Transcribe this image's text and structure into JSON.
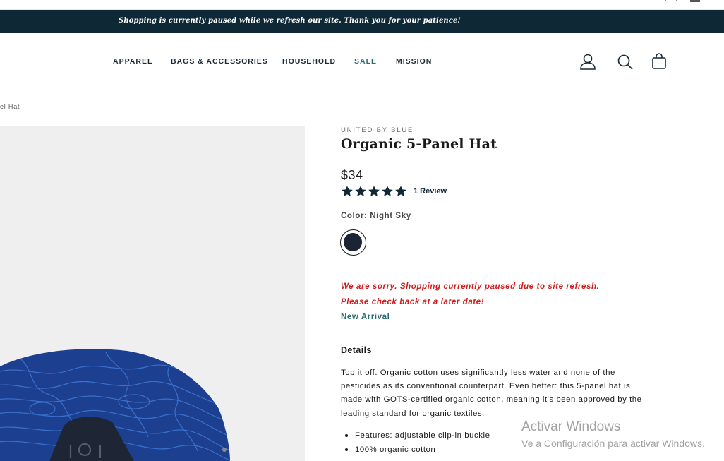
{
  "announcement": "Shopping is currently paused while we refresh our site. Thank you for your patience!",
  "nav": {
    "items": [
      "APPAREL",
      "BAGS & ACCESSORIES",
      "HOUSEHOLD",
      "SALE",
      "MISSION"
    ],
    "icons": [
      "account-icon",
      "search-icon",
      "cart-icon"
    ]
  },
  "breadcrumb": "el Hat",
  "product": {
    "brand": "UNITED BY BLUE",
    "title": "Organic 5-Panel Hat",
    "price": "$34",
    "rating": 5,
    "reviews_label": "1 Review",
    "color_label": "Color: Night Sky",
    "swatch_color": "#1c2332",
    "notice_line1": "We are sorry. Shopping currently paused due to site refresh.",
    "notice_line2": "Please check back at a later date!",
    "badge": "New Arrival",
    "details_heading": "Details",
    "description": "Top it off. Organic cotton uses significantly less water and none of the pesticides as its conventional counterpart. Even better: this 5-panel hat is made with GOTS-certified organic cotton, meaning it's been approved by the leading standard for organic textiles.",
    "features": [
      "Features: adjustable clip-in buckle",
      "100% organic cotton"
    ]
  },
  "watermark": {
    "line1": "Activar Windows",
    "line2": "Ve a Configuración para activar Windows."
  },
  "colors": {
    "header_bg": "#0e2836",
    "accent_teal": "#2a6b72",
    "alert_red": "#d11b1b",
    "gallery_bg": "#efefef"
  }
}
